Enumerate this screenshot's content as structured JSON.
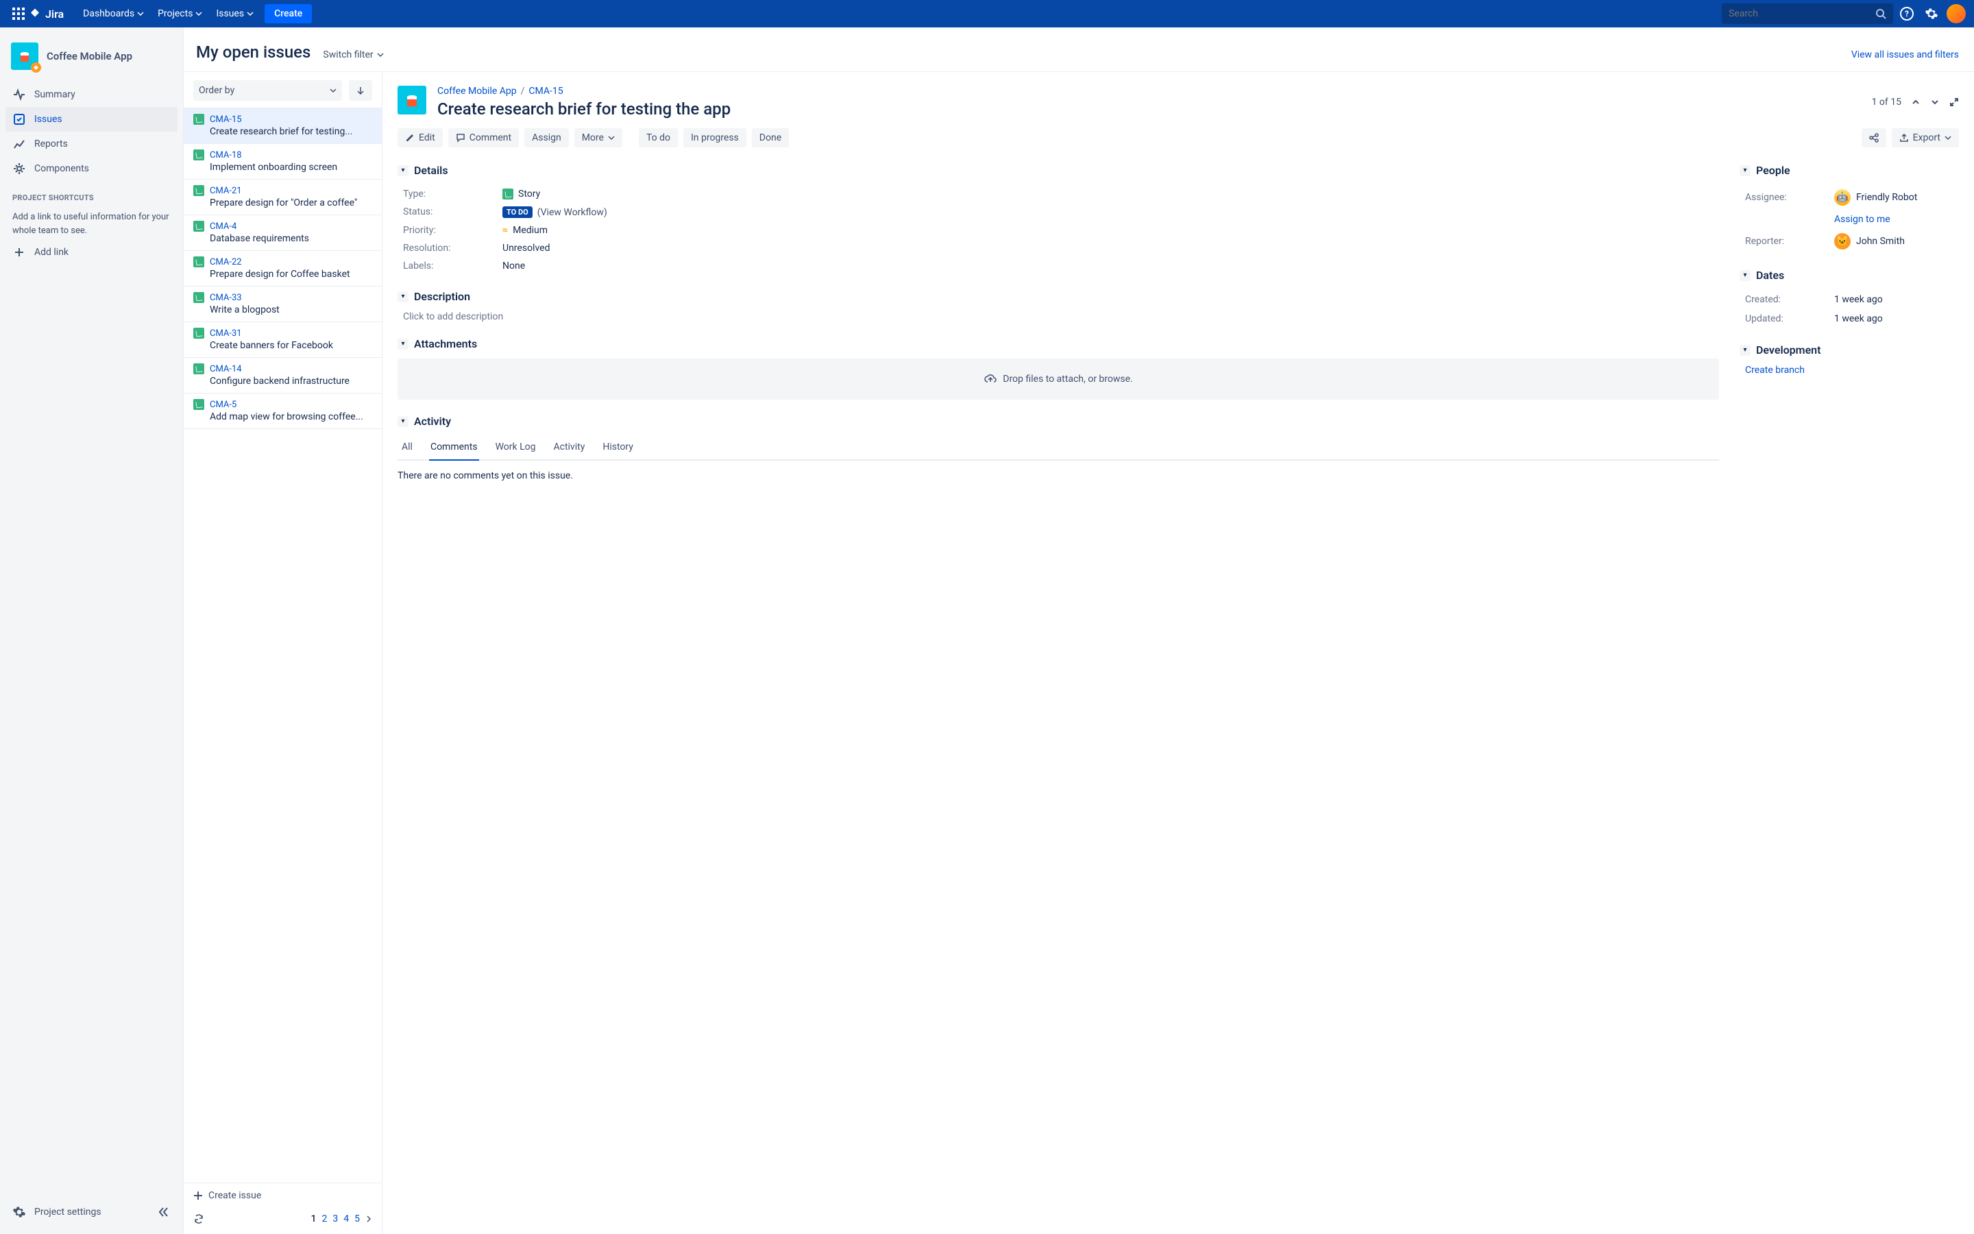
{
  "topnav": {
    "logo": "Jira",
    "links": [
      "Dashboards",
      "Projects",
      "Issues"
    ],
    "create": "Create",
    "search_placeholder": "Search"
  },
  "sidebar": {
    "project_name": "Coffee Mobile App",
    "items": [
      {
        "icon": "pulse",
        "label": "Summary"
      },
      {
        "icon": "issues",
        "label": "Issues"
      },
      {
        "icon": "reports",
        "label": "Reports"
      },
      {
        "icon": "components",
        "label": "Components"
      }
    ],
    "shortcuts_title": "PROJECT SHORTCUTS",
    "shortcuts_help": "Add a link to useful information for your whole team to see.",
    "add_link": "Add link",
    "settings": "Project settings"
  },
  "list": {
    "title": "My open issues",
    "switch_filter": "Switch filter",
    "view_all": "View all issues and filters",
    "order_by": "Order by",
    "issues": [
      {
        "key": "CMA-15",
        "summary": "Create research brief for testing..."
      },
      {
        "key": "CMA-18",
        "summary": "Implement onboarding screen"
      },
      {
        "key": "CMA-21",
        "summary": "Prepare design for \"Order a coffee\""
      },
      {
        "key": "CMA-4",
        "summary": "Database requirements"
      },
      {
        "key": "CMA-22",
        "summary": "Prepare design for Coffee basket"
      },
      {
        "key": "CMA-33",
        "summary": "Write a blogpost"
      },
      {
        "key": "CMA-31",
        "summary": "Create banners for Facebook"
      },
      {
        "key": "CMA-14",
        "summary": "Configure backend infrastructure"
      },
      {
        "key": "CMA-5",
        "summary": "Add map view for browsing coffee..."
      }
    ],
    "create_issue": "Create issue",
    "pages": [
      "1",
      "2",
      "3",
      "4",
      "5"
    ]
  },
  "detail": {
    "breadcrumb_project": "Coffee Mobile App",
    "breadcrumb_key": "CMA-15",
    "title": "Create research brief for testing the app",
    "pos": "1 of 15",
    "actions": {
      "edit": "Edit",
      "comment": "Comment",
      "assign": "Assign",
      "more": "More",
      "todo": "To do",
      "inprogress": "In progress",
      "done": "Done",
      "export": "Export"
    },
    "panels": {
      "details": "Details",
      "people": "People",
      "dates": "Dates",
      "development": "Development",
      "description": "Description",
      "attachments": "Attachments",
      "activity": "Activity"
    },
    "fields": {
      "type_label": "Type:",
      "type_val": "Story",
      "status_label": "Status:",
      "status_badge": "TO DO",
      "status_link": "(View Workflow)",
      "priority_label": "Priority:",
      "priority_val": "Medium",
      "resolution_label": "Resolution:",
      "resolution_val": "Unresolved",
      "labels_label": "Labels:",
      "labels_val": "None"
    },
    "people": {
      "assignee_label": "Assignee:",
      "assignee_val": "Friendly Robot",
      "assign_to_me": "Assign to me",
      "reporter_label": "Reporter:",
      "reporter_val": "John Smith"
    },
    "dates": {
      "created_label": "Created:",
      "created_val": "1 week ago",
      "updated_label": "Updated:",
      "updated_val": "1 week ago"
    },
    "development": {
      "create_branch": "Create branch"
    },
    "description_placeholder": "Click to add description",
    "attachments_hint": "Drop files to attach, or browse.",
    "activity_tabs": [
      "All",
      "Comments",
      "Work Log",
      "Activity",
      "History"
    ],
    "no_comments": "There are no comments yet on this issue."
  }
}
